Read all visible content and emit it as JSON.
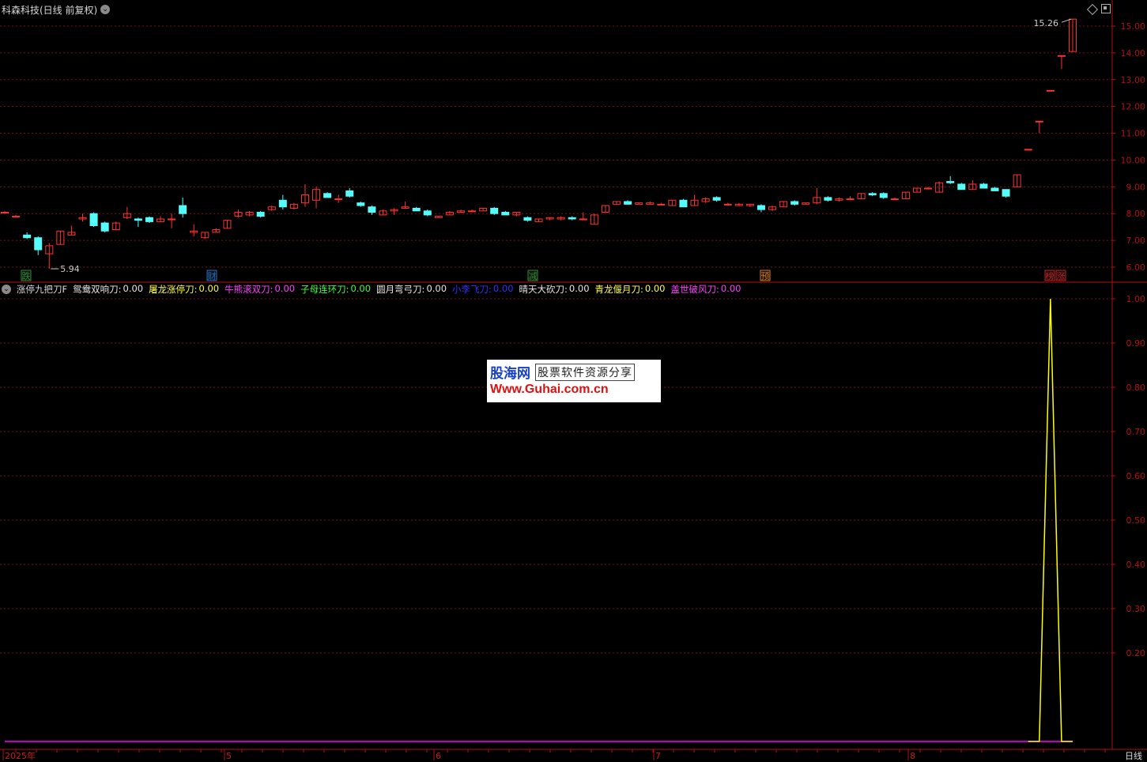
{
  "header": {
    "title": "科森科技(日线 前复权)",
    "dropdown_icon": "chevron-down-icon",
    "icons": [
      "diamond-icon",
      "restore-window-icon"
    ]
  },
  "colors": {
    "up": "#ff3232",
    "down": "#54fcfc",
    "grid": "#7a1010",
    "axis": "#b01010",
    "yellow_line": "#ffff00",
    "baseline": "#ff00ff"
  },
  "price_panel": {
    "high_label": "15.26",
    "low_label": "5.94",
    "y_axis": [
      "15.00",
      "14.00",
      "13.00",
      "12.00",
      "11.00",
      "10.00",
      "9.00",
      "8.00",
      "7.00",
      "6.00"
    ],
    "event_tags": [
      {
        "text": "跌",
        "color": "#2e8b2e"
      },
      {
        "text": "财",
        "color": "#1e6fd0"
      },
      {
        "text": "减",
        "color": "#2e8b2e"
      },
      {
        "text": "预",
        "color": "#d87a1a"
      },
      {
        "text": "榜",
        "color": "#c81e1e"
      },
      {
        "text": "涨",
        "color": "#c81e1e"
      }
    ]
  },
  "indicator_panel": {
    "name": "涨停九把刀F",
    "dropdown_icon": "chevron-down-icon",
    "items": [
      {
        "label": "鸳鸯双响刀:",
        "value": "0.00",
        "color": "#e6e6e6"
      },
      {
        "label": "屠龙涨停刀:",
        "value": "0.00",
        "color": "#ffff40"
      },
      {
        "label": "牛熊滚双刀:",
        "value": "0.00",
        "color": "#ff40ff"
      },
      {
        "label": "子母连环刀:",
        "value": "0.00",
        "color": "#40ff40"
      },
      {
        "label": "圆月弯弓刀:",
        "value": "0.00",
        "color": "#e6e6e6"
      },
      {
        "label": "小李飞刀:",
        "value": "0.00",
        "color": "#3030ff"
      },
      {
        "label": "晴天大砍刀:",
        "value": "0.00",
        "color": "#e6e6e6"
      },
      {
        "label": "青龙偃月刀:",
        "value": "0.00",
        "color": "#ffff40"
      },
      {
        "label": "盖世破风刀:",
        "value": "0.00",
        "color": "#ff40ff"
      }
    ],
    "y_axis": [
      "1.00",
      "0.90",
      "0.80",
      "0.70",
      "0.60",
      "0.50",
      "0.40",
      "0.30",
      "0.20"
    ]
  },
  "x_axis": [
    "2025年",
    "5",
    "6",
    "7",
    "8"
  ],
  "period_tab": "日线",
  "watermark": {
    "logo": "股海网",
    "slogan": "股票软件资源分享",
    "url": "Www.Guhai.com.cn"
  },
  "chart_data": {
    "type": "candlestick",
    "ylim": [
      5.5,
      15.5
    ],
    "candles": [
      {
        "o": 8.05,
        "h": 8.1,
        "l": 8.0,
        "c": 8.05
      },
      {
        "o": 7.9,
        "h": 7.95,
        "l": 7.85,
        "c": 7.9
      },
      {
        "o": 7.2,
        "h": 7.3,
        "l": 7.05,
        "c": 7.1
      },
      {
        "o": 7.1,
        "h": 7.15,
        "l": 6.45,
        "c": 6.65
      },
      {
        "o": 6.5,
        "h": 6.9,
        "l": 5.94,
        "c": 6.8
      },
      {
        "o": 6.85,
        "h": 7.35,
        "l": 6.85,
        "c": 7.35
      },
      {
        "o": 7.2,
        "h": 7.55,
        "l": 7.2,
        "c": 7.3
      },
      {
        "o": 7.8,
        "h": 8.0,
        "l": 7.7,
        "c": 7.85
      },
      {
        "o": 8.0,
        "h": 8.05,
        "l": 7.5,
        "c": 7.55
      },
      {
        "o": 7.65,
        "h": 7.7,
        "l": 7.3,
        "c": 7.35
      },
      {
        "o": 7.4,
        "h": 7.7,
        "l": 7.4,
        "c": 7.65
      },
      {
        "o": 7.85,
        "h": 8.25,
        "l": 7.8,
        "c": 8.0
      },
      {
        "o": 7.8,
        "h": 7.85,
        "l": 7.5,
        "c": 7.75
      },
      {
        "o": 7.85,
        "h": 7.9,
        "l": 7.65,
        "c": 7.7
      },
      {
        "o": 7.7,
        "h": 7.9,
        "l": 7.7,
        "c": 7.8
      },
      {
        "o": 7.8,
        "h": 8.0,
        "l": 7.45,
        "c": 7.8
      },
      {
        "o": 8.3,
        "h": 8.6,
        "l": 7.85,
        "c": 8.0
      },
      {
        "o": 7.3,
        "h": 7.6,
        "l": 7.15,
        "c": 7.35
      },
      {
        "o": 7.1,
        "h": 7.3,
        "l": 7.05,
        "c": 7.3
      },
      {
        "o": 7.3,
        "h": 7.45,
        "l": 7.3,
        "c": 7.4
      },
      {
        "o": 7.45,
        "h": 7.75,
        "l": 7.45,
        "c": 7.75
      },
      {
        "o": 7.9,
        "h": 8.15,
        "l": 7.85,
        "c": 8.05
      },
      {
        "o": 7.95,
        "h": 8.1,
        "l": 7.9,
        "c": 8.05
      },
      {
        "o": 8.05,
        "h": 8.1,
        "l": 7.85,
        "c": 7.9
      },
      {
        "o": 8.15,
        "h": 8.3,
        "l": 8.1,
        "c": 8.25
      },
      {
        "o": 8.5,
        "h": 8.7,
        "l": 8.15,
        "c": 8.25
      },
      {
        "o": 8.2,
        "h": 8.4,
        "l": 8.15,
        "c": 8.35
      },
      {
        "o": 8.4,
        "h": 9.1,
        "l": 8.25,
        "c": 8.7
      },
      {
        "o": 8.5,
        "h": 9.0,
        "l": 8.2,
        "c": 8.9
      },
      {
        "o": 8.75,
        "h": 8.8,
        "l": 8.6,
        "c": 8.6
      },
      {
        "o": 8.55,
        "h": 8.7,
        "l": 8.4,
        "c": 8.55
      },
      {
        "o": 8.85,
        "h": 8.95,
        "l": 8.6,
        "c": 8.65
      },
      {
        "o": 8.4,
        "h": 8.45,
        "l": 8.25,
        "c": 8.3
      },
      {
        "o": 8.25,
        "h": 8.3,
        "l": 7.95,
        "c": 8.05
      },
      {
        "o": 7.95,
        "h": 8.15,
        "l": 7.95,
        "c": 8.1
      },
      {
        "o": 8.1,
        "h": 8.2,
        "l": 7.95,
        "c": 8.15
      },
      {
        "o": 8.2,
        "h": 8.45,
        "l": 8.2,
        "c": 8.25
      },
      {
        "o": 8.2,
        "h": 8.25,
        "l": 8.1,
        "c": 8.1
      },
      {
        "o": 8.1,
        "h": 8.15,
        "l": 7.9,
        "c": 7.95
      },
      {
        "o": 7.85,
        "h": 7.9,
        "l": 7.85,
        "c": 7.9
      },
      {
        "o": 7.95,
        "h": 8.1,
        "l": 7.95,
        "c": 8.05
      },
      {
        "o": 8.05,
        "h": 8.15,
        "l": 8.05,
        "c": 8.1
      },
      {
        "o": 8.1,
        "h": 8.15,
        "l": 8.05,
        "c": 8.1
      },
      {
        "o": 8.1,
        "h": 8.2,
        "l": 8.1,
        "c": 8.2
      },
      {
        "o": 8.2,
        "h": 8.25,
        "l": 7.95,
        "c": 8.0
      },
      {
        "o": 8.05,
        "h": 8.1,
        "l": 7.95,
        "c": 7.95
      },
      {
        "o": 7.95,
        "h": 8.05,
        "l": 7.9,
        "c": 8.05
      },
      {
        "o": 7.85,
        "h": 7.9,
        "l": 7.7,
        "c": 7.75
      },
      {
        "o": 7.7,
        "h": 7.8,
        "l": 7.7,
        "c": 7.8
      },
      {
        "o": 7.8,
        "h": 7.85,
        "l": 7.75,
        "c": 7.85
      },
      {
        "o": 7.8,
        "h": 7.9,
        "l": 7.75,
        "c": 7.85
      },
      {
        "o": 7.85,
        "h": 7.9,
        "l": 7.75,
        "c": 7.8
      },
      {
        "o": 7.8,
        "h": 8.05,
        "l": 7.75,
        "c": 7.8
      },
      {
        "o": 7.6,
        "h": 8.0,
        "l": 7.6,
        "c": 7.95
      },
      {
        "o": 8.05,
        "h": 8.3,
        "l": 8.05,
        "c": 8.3
      },
      {
        "o": 8.35,
        "h": 8.45,
        "l": 8.35,
        "c": 8.45
      },
      {
        "o": 8.45,
        "h": 8.5,
        "l": 8.35,
        "c": 8.35
      },
      {
        "o": 8.35,
        "h": 8.4,
        "l": 8.35,
        "c": 8.4
      },
      {
        "o": 8.35,
        "h": 8.45,
        "l": 8.35,
        "c": 8.4
      },
      {
        "o": 8.35,
        "h": 8.4,
        "l": 8.3,
        "c": 8.35
      },
      {
        "o": 8.3,
        "h": 8.5,
        "l": 8.3,
        "c": 8.5
      },
      {
        "o": 8.5,
        "h": 8.55,
        "l": 8.25,
        "c": 8.25
      },
      {
        "o": 8.3,
        "h": 8.7,
        "l": 8.3,
        "c": 8.5
      },
      {
        "o": 8.45,
        "h": 8.6,
        "l": 8.4,
        "c": 8.55
      },
      {
        "o": 8.6,
        "h": 8.65,
        "l": 8.45,
        "c": 8.5
      },
      {
        "o": 8.35,
        "h": 8.4,
        "l": 8.3,
        "c": 8.35
      },
      {
        "o": 8.3,
        "h": 8.4,
        "l": 8.3,
        "c": 8.35
      },
      {
        "o": 8.3,
        "h": 8.35,
        "l": 8.25,
        "c": 8.35
      },
      {
        "o": 8.3,
        "h": 8.35,
        "l": 8.05,
        "c": 8.15
      },
      {
        "o": 8.15,
        "h": 8.3,
        "l": 8.1,
        "c": 8.25
      },
      {
        "o": 8.25,
        "h": 8.45,
        "l": 8.25,
        "c": 8.45
      },
      {
        "o": 8.45,
        "h": 8.5,
        "l": 8.3,
        "c": 8.35
      },
      {
        "o": 8.35,
        "h": 8.4,
        "l": 8.35,
        "c": 8.4
      },
      {
        "o": 8.4,
        "h": 8.95,
        "l": 8.35,
        "c": 8.6
      },
      {
        "o": 8.6,
        "h": 8.65,
        "l": 8.45,
        "c": 8.5
      },
      {
        "o": 8.5,
        "h": 8.6,
        "l": 8.45,
        "c": 8.55
      },
      {
        "o": 8.55,
        "h": 8.65,
        "l": 8.5,
        "c": 8.55
      },
      {
        "o": 8.55,
        "h": 8.75,
        "l": 8.55,
        "c": 8.75
      },
      {
        "o": 8.75,
        "h": 8.8,
        "l": 8.65,
        "c": 8.7
      },
      {
        "o": 8.75,
        "h": 8.8,
        "l": 8.55,
        "c": 8.6
      },
      {
        "o": 8.55,
        "h": 8.6,
        "l": 8.5,
        "c": 8.55
      },
      {
        "o": 8.55,
        "h": 8.8,
        "l": 8.55,
        "c": 8.8
      },
      {
        "o": 8.8,
        "h": 8.95,
        "l": 8.8,
        "c": 8.95
      },
      {
        "o": 8.95,
        "h": 9.0,
        "l": 8.9,
        "c": 8.95
      },
      {
        "o": 8.8,
        "h": 9.2,
        "l": 8.8,
        "c": 9.15
      },
      {
        "o": 9.2,
        "h": 9.4,
        "l": 9.1,
        "c": 9.15
      },
      {
        "o": 9.1,
        "h": 9.15,
        "l": 8.9,
        "c": 8.9
      },
      {
        "o": 8.9,
        "h": 9.25,
        "l": 8.9,
        "c": 9.1
      },
      {
        "o": 9.1,
        "h": 9.15,
        "l": 8.95,
        "c": 8.95
      },
      {
        "o": 8.95,
        "h": 9.0,
        "l": 8.85,
        "c": 8.85
      },
      {
        "o": 8.9,
        "h": 8.9,
        "l": 8.6,
        "c": 8.65
      },
      {
        "o": 9.0,
        "h": 9.45,
        "l": 9.0,
        "c": 9.45
      },
      {
        "o": 10.4,
        "h": 10.4,
        "l": 10.4,
        "c": 10.4
      },
      {
        "o": 11.45,
        "h": 11.45,
        "l": 11.0,
        "c": 11.45
      },
      {
        "o": 12.6,
        "h": 12.6,
        "l": 12.6,
        "c": 12.6
      },
      {
        "o": 13.9,
        "h": 13.9,
        "l": 13.4,
        "c": 13.9
      },
      {
        "o": 14.05,
        "h": 15.26,
        "l": 14.05,
        "c": 15.26
      }
    ],
    "indicator_series": {
      "name": "屠龙涨停刀",
      "ylim": [
        0,
        1.05
      ],
      "values_tail": [
        0,
        0,
        1,
        0,
        0
      ]
    }
  }
}
